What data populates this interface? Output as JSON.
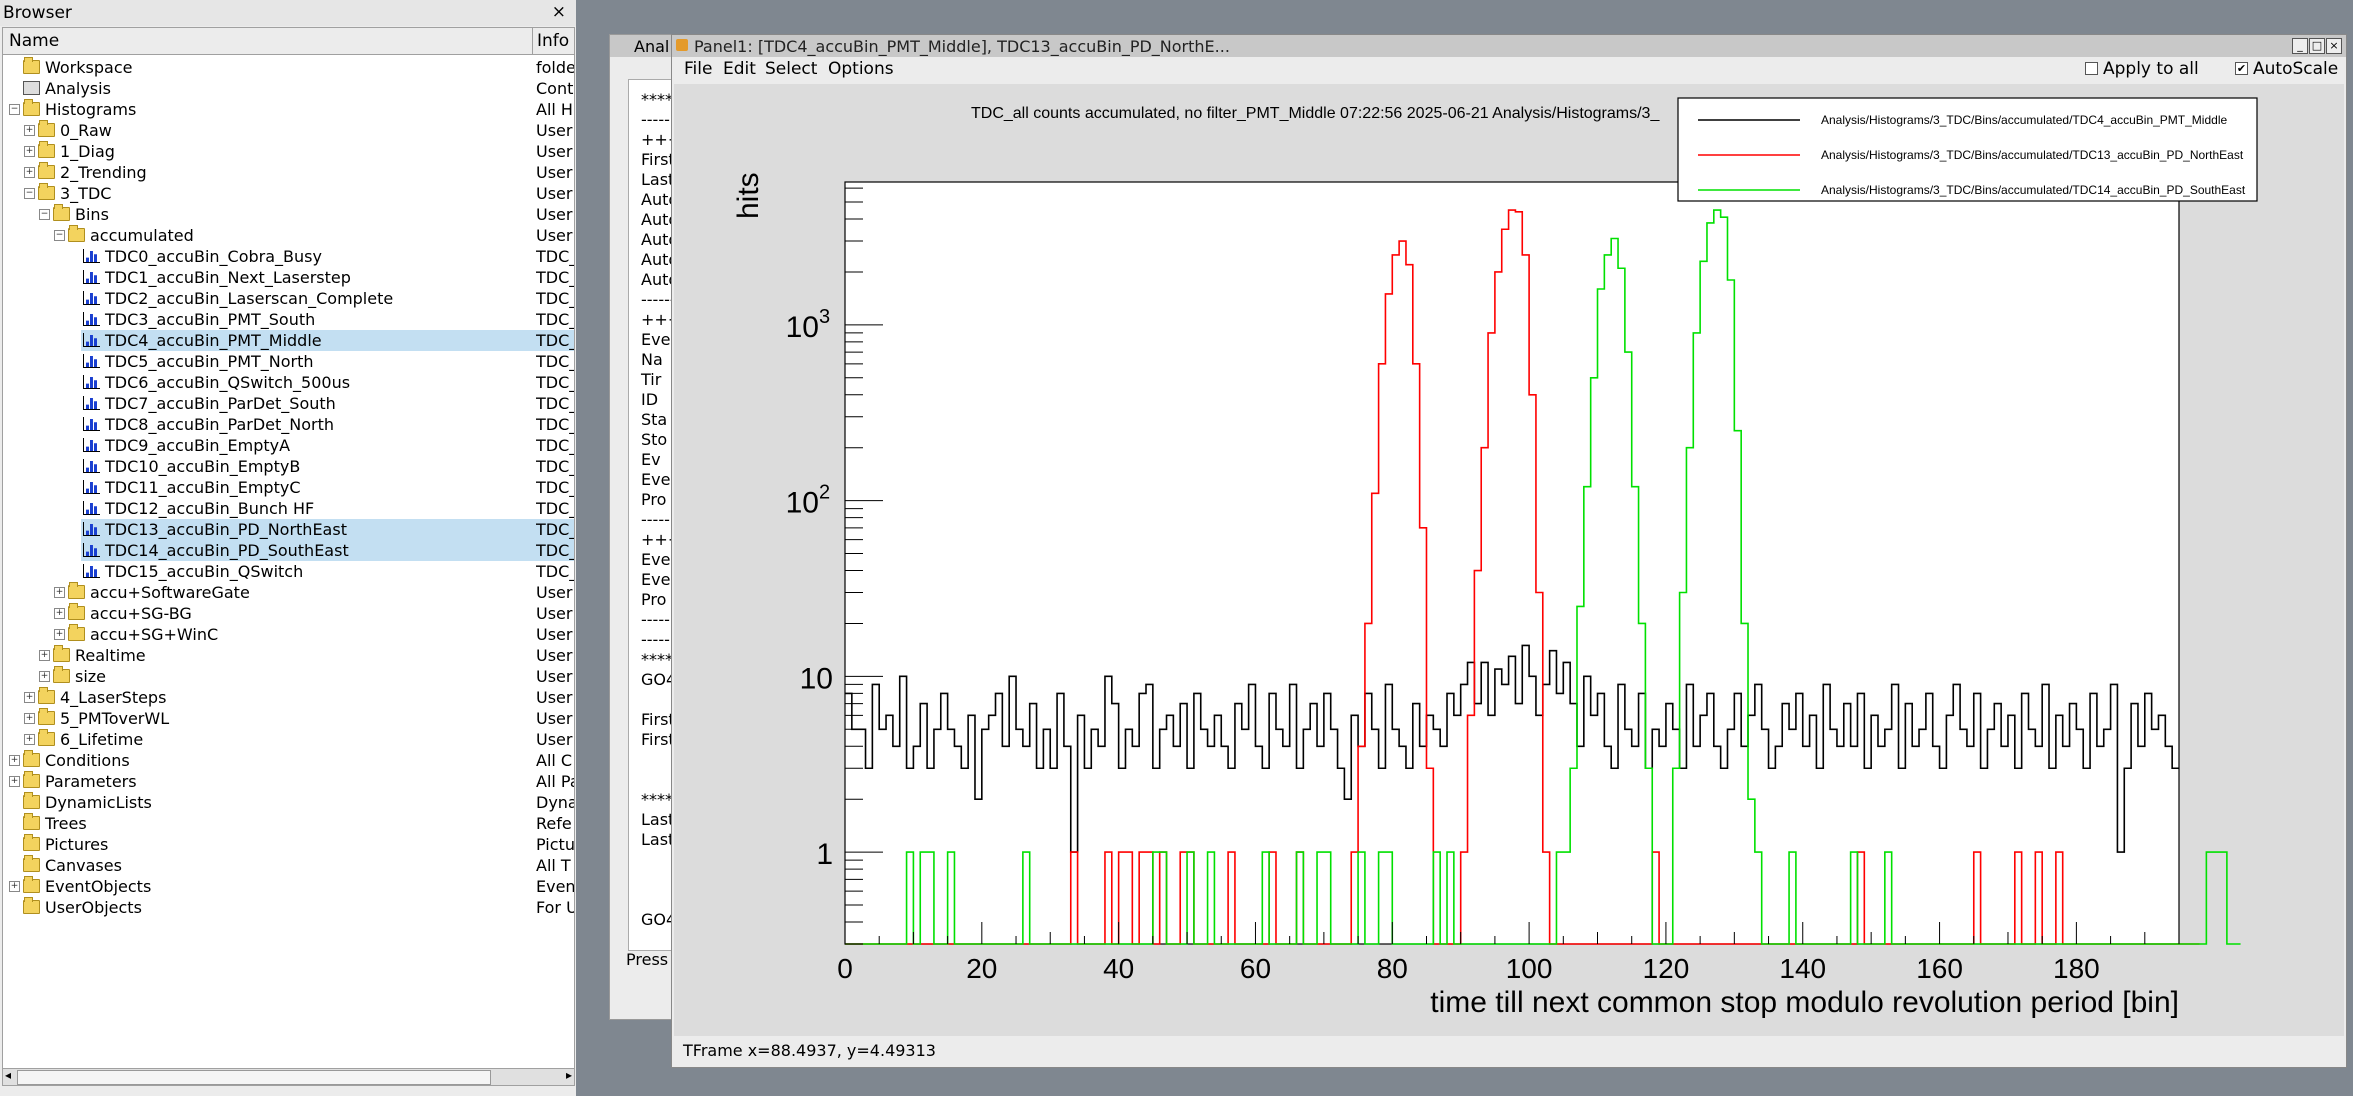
{
  "browser": {
    "title": "Browser",
    "close": "×",
    "col_name": "Name",
    "col_info": "Info",
    "items": [
      {
        "name": "Workspace",
        "info": "folde",
        "level": 0,
        "icon": "folder",
        "exp": ""
      },
      {
        "name": "Analysis",
        "info": "Cont",
        "level": 0,
        "icon": "workspace",
        "exp": ""
      },
      {
        "name": "Histograms",
        "info": "All H",
        "level": 0,
        "icon": "folder",
        "exp": "−"
      },
      {
        "name": "0_Raw",
        "info": "User",
        "level": 1,
        "icon": "folder",
        "exp": "+"
      },
      {
        "name": "1_Diag",
        "info": "User",
        "level": 1,
        "icon": "folder",
        "exp": "+"
      },
      {
        "name": "2_Trending",
        "info": "User",
        "level": 1,
        "icon": "folder",
        "exp": "+"
      },
      {
        "name": "3_TDC",
        "info": "User",
        "level": 1,
        "icon": "folder",
        "exp": "−"
      },
      {
        "name": "Bins",
        "info": "User",
        "level": 2,
        "icon": "folder",
        "exp": "−"
      },
      {
        "name": "accumulated",
        "info": "User",
        "level": 3,
        "icon": "folder",
        "exp": "−"
      },
      {
        "name": "TDC0_accuBin_Cobra_Busy",
        "info": "TDC_",
        "level": 4,
        "icon": "hist",
        "exp": ""
      },
      {
        "name": "TDC1_accuBin_Next_Laserstep",
        "info": "TDC_",
        "level": 4,
        "icon": "hist",
        "exp": ""
      },
      {
        "name": "TDC2_accuBin_Laserscan_Complete",
        "info": "TDC_",
        "level": 4,
        "icon": "hist",
        "exp": ""
      },
      {
        "name": "TDC3_accuBin_PMT_South",
        "info": "TDC_",
        "level": 4,
        "icon": "hist",
        "exp": ""
      },
      {
        "name": "TDC4_accuBin_PMT_Middle",
        "info": "TDC_",
        "level": 4,
        "icon": "hist",
        "exp": "",
        "sel": true
      },
      {
        "name": "TDC5_accuBin_PMT_North",
        "info": "TDC_",
        "level": 4,
        "icon": "hist",
        "exp": ""
      },
      {
        "name": "TDC6_accuBin_QSwitch_500us",
        "info": "TDC_",
        "level": 4,
        "icon": "hist",
        "exp": ""
      },
      {
        "name": "TDC7_accuBin_ParDet_South",
        "info": "TDC_",
        "level": 4,
        "icon": "hist",
        "exp": ""
      },
      {
        "name": "TDC8_accuBin_ParDet_North",
        "info": "TDC_",
        "level": 4,
        "icon": "hist",
        "exp": ""
      },
      {
        "name": "TDC9_accuBin_EmptyA",
        "info": "TDC_",
        "level": 4,
        "icon": "hist",
        "exp": ""
      },
      {
        "name": "TDC10_accuBin_EmptyB",
        "info": "TDC_",
        "level": 4,
        "icon": "hist",
        "exp": ""
      },
      {
        "name": "TDC11_accuBin_EmptyC",
        "info": "TDC_",
        "level": 4,
        "icon": "hist",
        "exp": ""
      },
      {
        "name": "TDC12_accuBin_Bunch HF",
        "info": "TDC_",
        "level": 4,
        "icon": "hist",
        "exp": ""
      },
      {
        "name": "TDC13_accuBin_PD_NorthEast",
        "info": "TDC_",
        "level": 4,
        "icon": "hist",
        "exp": "",
        "sel": true
      },
      {
        "name": "TDC14_accuBin_PD_SouthEast",
        "info": "TDC_",
        "level": 4,
        "icon": "hist",
        "exp": "",
        "sel": true
      },
      {
        "name": "TDC15_accuBin_QSwitch",
        "info": "TDC_",
        "level": 4,
        "icon": "hist",
        "exp": ""
      },
      {
        "name": "accu+SoftwareGate",
        "info": "User",
        "level": 3,
        "icon": "folder",
        "exp": "+"
      },
      {
        "name": "accu+SG-BG",
        "info": "User",
        "level": 3,
        "icon": "folder",
        "exp": "+"
      },
      {
        "name": "accu+SG+WinC",
        "info": "User",
        "level": 3,
        "icon": "folder",
        "exp": "+"
      },
      {
        "name": "Realtime",
        "info": "User",
        "level": 2,
        "icon": "folder",
        "exp": "+"
      },
      {
        "name": "size",
        "info": "User",
        "level": 2,
        "icon": "folder",
        "exp": "+"
      },
      {
        "name": "4_LaserSteps",
        "info": "User",
        "level": 1,
        "icon": "folder",
        "exp": "+"
      },
      {
        "name": "5_PMToverWL",
        "info": "User",
        "level": 1,
        "icon": "folder",
        "exp": "+"
      },
      {
        "name": "6_Lifetime",
        "info": "User",
        "level": 1,
        "icon": "folder",
        "exp": "+"
      },
      {
        "name": "Conditions",
        "info": "All C",
        "level": 0,
        "icon": "folder",
        "exp": "+"
      },
      {
        "name": "Parameters",
        "info": "All Pa",
        "level": 0,
        "icon": "folder",
        "exp": "+"
      },
      {
        "name": "DynamicLists",
        "info": "Dyna",
        "level": 0,
        "icon": "folder",
        "exp": ""
      },
      {
        "name": "Trees",
        "info": "Refe",
        "level": 0,
        "icon": "folder",
        "exp": ""
      },
      {
        "name": "Pictures",
        "info": "Pictu",
        "level": 0,
        "icon": "folder",
        "exp": ""
      },
      {
        "name": "Canvases",
        "info": "All T",
        "level": 0,
        "icon": "folder",
        "exp": ""
      },
      {
        "name": "EventObjects",
        "info": "Even",
        "level": 0,
        "icon": "folder",
        "exp": "+"
      },
      {
        "name": "UserObjects",
        "info": "For U",
        "level": 0,
        "icon": "folder",
        "exp": ""
      }
    ]
  },
  "bgwin": {
    "title": "Anal",
    "lines": [
      "****",
      "-----",
      "+++",
      "First",
      "Last",
      "Autos",
      "Autos",
      "Autos",
      "Autos",
      "Autos",
      "------",
      "+++",
      "Eve",
      "Na",
      "Tir",
      "ID",
      "Sta",
      "Sto",
      "Ev",
      "Eve",
      "Pro",
      "-----",
      "+++",
      "Eve",
      "Eve",
      "Pro",
      "-----",
      "-----",
      "*****",
      "GO4-",
      "",
      "First",
      "First",
      "",
      "",
      "****",
      "Last",
      "Last",
      "",
      "",
      "",
      "GO4-"
    ],
    "press": "Press"
  },
  "panel": {
    "title": "Panel1: [TDC4_accuBin_PMT_Middle], TDC13_accuBin_PD_NorthE...",
    "menu": {
      "file": "File",
      "edit": "Edit",
      "select": "Select",
      "options": "Options"
    },
    "apply_all": "Apply to all",
    "autoscale": "AutoScale",
    "autoscale_check": "✔",
    "status": "TFrame  x=88.4937, y=4.49313"
  },
  "chart_data": {
    "type": "histogram-step",
    "title": "TDC_all counts accumulated, no filter_PMT_Middle  07:22:56  2025-06-21  Analysis/Histograms/3_",
    "xlabel": "time till next common stop modulo revolution period [bin]",
    "ylabel": "hits",
    "xlim": [
      0,
      195
    ],
    "ylim": [
      0.3,
      6500
    ],
    "log_y": true,
    "x_ticks": [
      "0",
      "20",
      "40",
      "60",
      "80",
      "100",
      "120",
      "140",
      "160",
      "180"
    ],
    "y_ticks": [
      {
        "v": 1,
        "base": "1",
        "exp": ""
      },
      {
        "v": 10,
        "base": "10",
        "exp": ""
      },
      {
        "v": 100,
        "base": "10",
        "exp": "2"
      },
      {
        "v": 1000,
        "base": "10",
        "exp": "3"
      }
    ],
    "legend_position": "top-right",
    "series": [
      {
        "name": "Analysis/Histograms/3_TDC/Bins/accumulated/TDC4_accuBin_PMT_Middle",
        "color": "#000000",
        "values": [
          8,
          5,
          5,
          3,
          9,
          5,
          6,
          4,
          10,
          3,
          4,
          7,
          3,
          5,
          8,
          5,
          4,
          3,
          6,
          2,
          5,
          6,
          8,
          4,
          10,
          5,
          4,
          7,
          3,
          5,
          3,
          8,
          4,
          1,
          6,
          3,
          5,
          4,
          10,
          7,
          3,
          5,
          4,
          8,
          9,
          3,
          5,
          6,
          4,
          7,
          3,
          8,
          5,
          4,
          6,
          4,
          3,
          7,
          5,
          9,
          4,
          3,
          8,
          5,
          4,
          9,
          3,
          5,
          7,
          4,
          8,
          5,
          3,
          2,
          6,
          4,
          8,
          5,
          3,
          9,
          5,
          4,
          3,
          7,
          4,
          6,
          5,
          4,
          8,
          6,
          9,
          12,
          7,
          12,
          6,
          11,
          9,
          13,
          7,
          15,
          10,
          6,
          9,
          14,
          8,
          12,
          7,
          4,
          10,
          6,
          8,
          4,
          3,
          9,
          5,
          4,
          8,
          3,
          5,
          4,
          7,
          5,
          3,
          9,
          4,
          6,
          8,
          4,
          3,
          5,
          8,
          4,
          6,
          9,
          5,
          3,
          4,
          7,
          5,
          8,
          4,
          6,
          3,
          9,
          5,
          4,
          7,
          4,
          8,
          3,
          6,
          4,
          5,
          9,
          3,
          7,
          4,
          5,
          8,
          4,
          3,
          6,
          9,
          5,
          4,
          8,
          3,
          5,
          7,
          4,
          6,
          3,
          8,
          5,
          4,
          9,
          3,
          6,
          4,
          7,
          5,
          3,
          8,
          4,
          5,
          9,
          1,
          3,
          7,
          4,
          8,
          5,
          6,
          4,
          3
        ]
      },
      {
        "name": "Analysis/Histograms/3_TDC/Bins/accumulated/TDC13_accuBin_PD_NorthEast",
        "color": "#ff0000",
        "values": [
          0,
          0,
          0,
          0,
          0,
          0,
          0,
          0,
          0,
          0,
          0,
          0,
          0,
          0,
          0,
          0,
          0,
          0,
          0,
          0,
          0,
          0,
          0,
          0,
          0,
          0,
          0,
          0,
          0,
          0,
          0,
          0,
          0,
          1,
          0,
          0,
          0,
          0,
          1,
          0,
          1,
          1,
          0,
          1,
          1,
          0,
          1,
          0,
          0,
          1,
          1,
          0,
          0,
          0,
          0,
          0,
          1,
          0,
          0,
          0,
          0,
          0,
          1,
          0,
          0,
          0,
          1,
          0,
          0,
          0,
          0,
          0,
          0,
          0,
          1,
          4,
          20,
          110,
          600,
          1500,
          2500,
          3000,
          2200,
          600,
          70,
          3,
          0,
          0,
          0,
          0,
          1,
          6,
          40,
          200,
          900,
          2000,
          3500,
          4500,
          4400,
          2500,
          400,
          30,
          1,
          0,
          0,
          0,
          0,
          0,
          0,
          0,
          0,
          0,
          0,
          0,
          0,
          0,
          0,
          0,
          1,
          0,
          0,
          0,
          0,
          0,
          0,
          0,
          0,
          0,
          0,
          0,
          0,
          0,
          0,
          0,
          0,
          0,
          0,
          0,
          0,
          0,
          0,
          0,
          0,
          0,
          0,
          0,
          0,
          0,
          1,
          0,
          0,
          0,
          0,
          0,
          0,
          0,
          0,
          0,
          0,
          0,
          0,
          0,
          0,
          0,
          0,
          1,
          0,
          0,
          0,
          0,
          0,
          1,
          0,
          0,
          1,
          0,
          0,
          1,
          0,
          0,
          0,
          0,
          0,
          0,
          0,
          0,
          0,
          0,
          0,
          0,
          0,
          0,
          0,
          0,
          0,
          0,
          0,
          0
        ]
      },
      {
        "name": "Analysis/Histograms/3_TDC/Bins/accumulated/TDC14_accuBin_PD_SouthEast",
        "color": "#00e000",
        "values": [
          0,
          0,
          0,
          0,
          0,
          0,
          0,
          0,
          0,
          1,
          0,
          1,
          1,
          0,
          0,
          1,
          0,
          0,
          0,
          0,
          0,
          0,
          0,
          0,
          0,
          0,
          1,
          0,
          0,
          0,
          0,
          0,
          0,
          0,
          0,
          0,
          0,
          0,
          0,
          0,
          0,
          0,
          0,
          0,
          0,
          1,
          1,
          0,
          0,
          0,
          1,
          0,
          0,
          1,
          0,
          0,
          0,
          0,
          0,
          0,
          0,
          1,
          0,
          0,
          0,
          0,
          1,
          0,
          0,
          1,
          1,
          0,
          0,
          0,
          0,
          1,
          0,
          0,
          1,
          1,
          0,
          0,
          0,
          0,
          0,
          0,
          1,
          0,
          1,
          0,
          0,
          0,
          0,
          0,
          0,
          0,
          0,
          0,
          0,
          0,
          0,
          0,
          0,
          0,
          1,
          1,
          3,
          25,
          120,
          500,
          1600,
          2500,
          3100,
          2100,
          700,
          120,
          20,
          3,
          0,
          0,
          0,
          3,
          30,
          200,
          900,
          2300,
          3800,
          4500,
          4100,
          1800,
          250,
          20,
          2,
          1,
          0,
          0,
          0,
          0,
          1,
          0,
          0,
          0,
          0,
          0,
          0,
          0,
          0,
          1,
          0,
          0,
          0,
          0,
          1,
          0,
          0,
          0,
          0,
          0,
          0,
          0,
          0,
          0,
          0,
          0,
          0,
          0,
          0,
          0,
          0,
          0,
          0,
          0,
          0,
          0,
          0,
          0,
          0,
          0,
          0,
          0,
          0,
          0,
          0,
          0,
          0,
          0,
          0,
          0,
          0,
          0,
          0,
          0,
          0,
          0,
          0,
          0,
          0,
          0,
          0,
          1,
          1,
          1,
          0,
          0
        ]
      }
    ]
  }
}
